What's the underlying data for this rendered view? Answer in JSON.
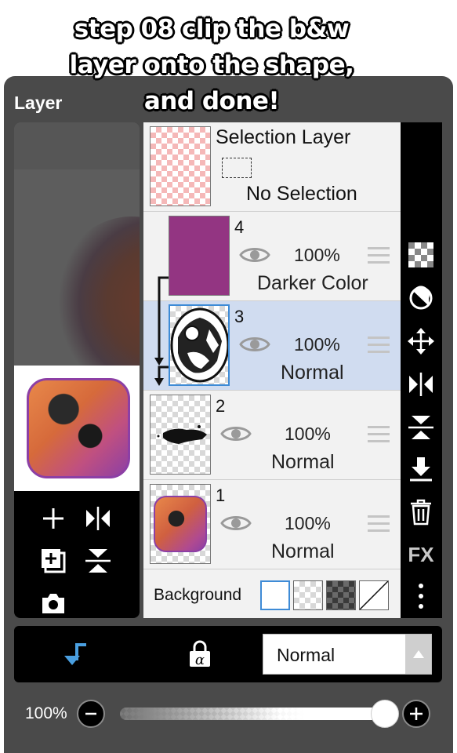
{
  "caption": {
    "line1": "step 08   clip the b&w",
    "line2": "layer onto the shape,",
    "line3": "and done!"
  },
  "panel": {
    "title": "Layer"
  },
  "selection_layer": {
    "title": "Selection Layer",
    "status": "No Selection"
  },
  "layers": [
    {
      "number": "4",
      "opacity": "100%",
      "blend": "Darker Color",
      "color": "#933582",
      "selected": false,
      "clipped": true
    },
    {
      "number": "3",
      "opacity": "100%",
      "blend": "Normal",
      "selected": true,
      "clipped": true
    },
    {
      "number": "2",
      "opacity": "100%",
      "blend": "Normal",
      "selected": false,
      "clipped": false
    },
    {
      "number": "1",
      "opacity": "100%",
      "blend": "Normal",
      "selected": false,
      "clipped": false
    }
  ],
  "background": {
    "label": "Background",
    "selected": "white"
  },
  "left_tools": [
    "add-icon",
    "flip-horizontal-icon",
    "duplicate-icon",
    "flip-vertical-icon",
    "camera-icon"
  ],
  "right_tools": [
    "transparency-icon",
    "brightness-icon",
    "move-icon",
    "flip-horizontal-icon",
    "flip-vertical-icon",
    "merge-down-icon",
    "trash-icon",
    "fx-icon",
    "more-icon"
  ],
  "right_tool_fx": "FX",
  "bottom": {
    "blend_mode": "Normal",
    "clip_icon": "clip-arrow-icon",
    "lock_icon": "alpha-lock-icon",
    "lock_glyph": "α"
  },
  "opacity_control": {
    "label": "100%",
    "value": 1.0
  },
  "colors": {
    "accent": "#4a9fe0",
    "panel": "#4a4a4a",
    "selected_row": "#d0dcf0",
    "layer4_fill": "#933582"
  }
}
